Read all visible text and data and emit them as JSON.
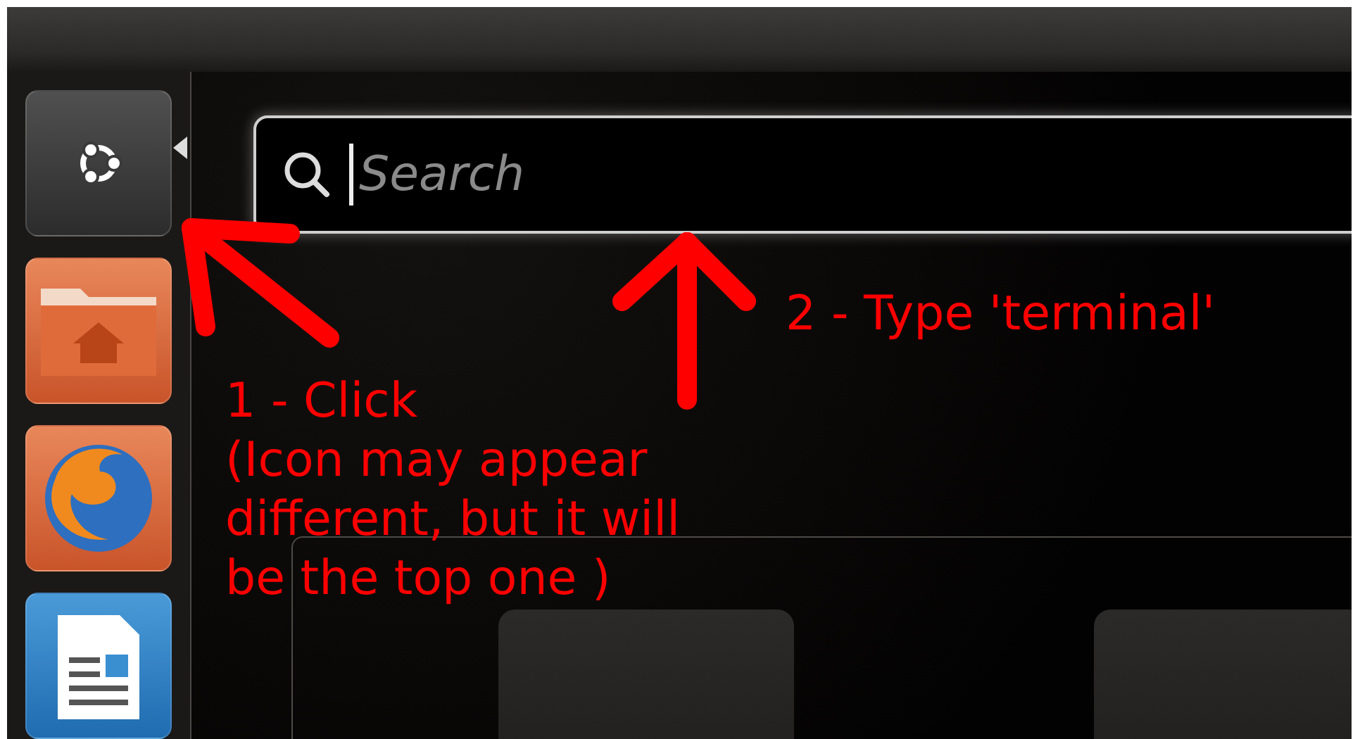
{
  "launcher": {
    "items": [
      {
        "kind": "dash"
      },
      {
        "kind": "home"
      },
      {
        "kind": "browser"
      },
      {
        "kind": "writer"
      }
    ]
  },
  "search": {
    "placeholder": "Search"
  },
  "annotations": [
    {
      "text": "1 - Click"
    },
    {
      "text": "(Icon may appear different, but it will be the top one )"
    },
    {
      "text": "2 - Type 'terminal'"
    }
  ]
}
